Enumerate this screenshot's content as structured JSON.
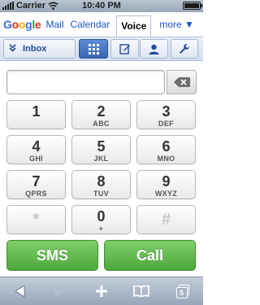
{
  "status_bar": {
    "carrier": "Carrier",
    "time": "10:40 PM"
  },
  "google_nav": {
    "logo": "Google",
    "items": [
      {
        "label": "Mail"
      },
      {
        "label": "Calendar"
      },
      {
        "label": "Voice",
        "active": true
      },
      {
        "label": "more ▼"
      }
    ]
  },
  "voice_toolbar": {
    "inbox_label": "Inbox",
    "icons": [
      "keypad-icon",
      "compose-icon",
      "contacts-icon",
      "settings-icon"
    ],
    "active": "keypad"
  },
  "number_field": {
    "value": ""
  },
  "keypad": [
    {
      "digit": "1",
      "letters": ""
    },
    {
      "digit": "2",
      "letters": "ABC"
    },
    {
      "digit": "3",
      "letters": "DEF"
    },
    {
      "digit": "4",
      "letters": "GHI"
    },
    {
      "digit": "5",
      "letters": "JKL"
    },
    {
      "digit": "6",
      "letters": "MNO"
    },
    {
      "digit": "7",
      "letters": "QPRS"
    },
    {
      "digit": "8",
      "letters": "TUV"
    },
    {
      "digit": "9",
      "letters": "WXYZ"
    },
    {
      "digit": "*",
      "letters": ""
    },
    {
      "digit": "0",
      "letters": "+"
    },
    {
      "digit": "#",
      "letters": ""
    }
  ],
  "actions": {
    "sms": "SMS",
    "call": "Call"
  },
  "safari_toolbar": {
    "pages_count": "5"
  },
  "colors": {
    "call_green": "#4ea83c",
    "link_blue": "#1a55c8",
    "active_segment": "#3a66b4"
  }
}
